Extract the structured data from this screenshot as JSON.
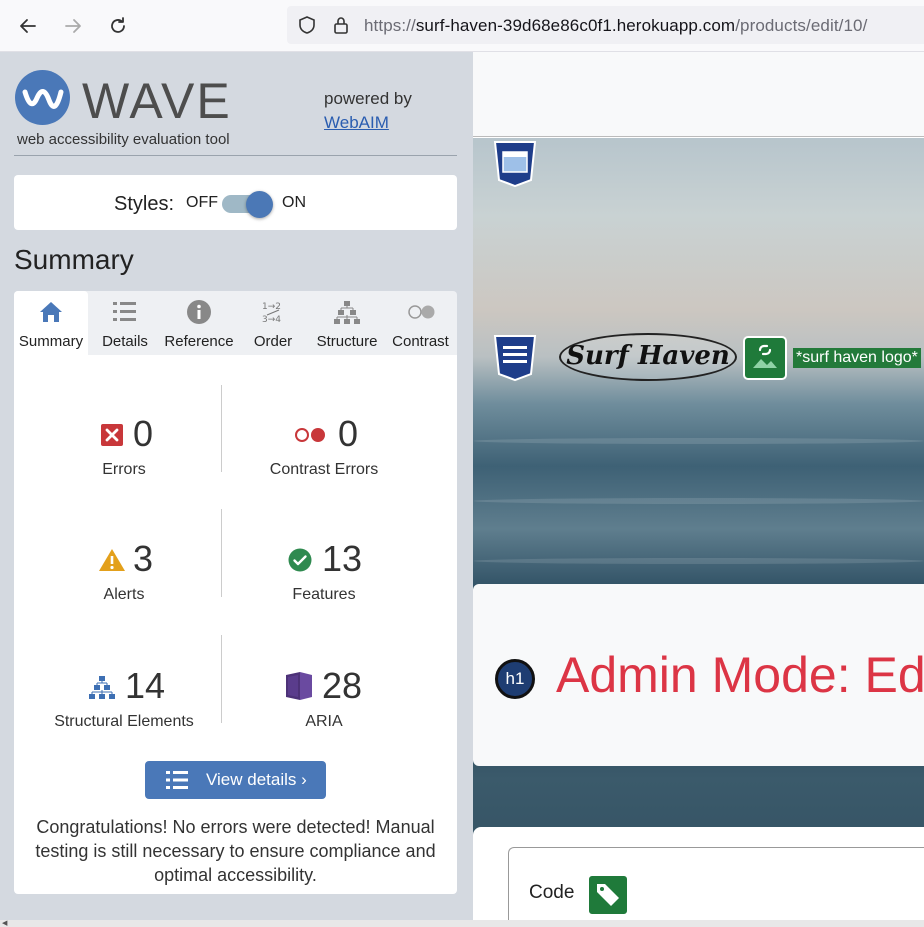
{
  "browser": {
    "url_prefix": "https://",
    "url_host": "surf-haven-39d68e86c0f1.herokuapp.com",
    "url_path": "/products/edit/10/"
  },
  "wave": {
    "brand": "WAVE",
    "subtitle": "web accessibility evaluation tool",
    "powered_by": "powered by",
    "webaim_link": "WebAIM",
    "styles_label": "Styles:",
    "off_label": "OFF",
    "on_label": "ON",
    "styles_on": true,
    "summary_heading": "Summary",
    "tabs": [
      {
        "label": "Summary",
        "icon": "home-icon",
        "active": true
      },
      {
        "label": "Details",
        "icon": "list-icon",
        "active": false
      },
      {
        "label": "Reference",
        "icon": "info-icon",
        "active": false
      },
      {
        "label": "Order",
        "icon": "order-icon",
        "active": false
      },
      {
        "label": "Structure",
        "icon": "structure-icon",
        "active": false
      },
      {
        "label": "Contrast",
        "icon": "contrast-icon",
        "active": false
      }
    ],
    "stats": {
      "errors": {
        "count": "0",
        "label": "Errors"
      },
      "contrast_errors": {
        "count": "0",
        "label": "Contrast Errors"
      },
      "alerts": {
        "count": "3",
        "label": "Alerts"
      },
      "features": {
        "count": "13",
        "label": "Features"
      },
      "structural": {
        "count": "14",
        "label": "Structural Elements"
      },
      "aria": {
        "count": "28",
        "label": "ARIA"
      }
    },
    "view_details_label": "View details ›",
    "congrats_text": "Congratulations! No errors were detected! Manual testing is still necessary to ensure compliance and optimal accessibility."
  },
  "page": {
    "logo_text": "Surf Haven",
    "logo_alt": "*surf haven logo*",
    "h1_badge": "h1",
    "admin_title": "Admin Mode: Edi",
    "code_label": "Code"
  },
  "colors": {
    "wave_blue": "#4a78b8",
    "error_red": "#c8373a",
    "alert_orange": "#e3a01b",
    "feature_green": "#2f8a50",
    "aria_purple": "#4d3278",
    "admin_red": "#dc3545"
  }
}
